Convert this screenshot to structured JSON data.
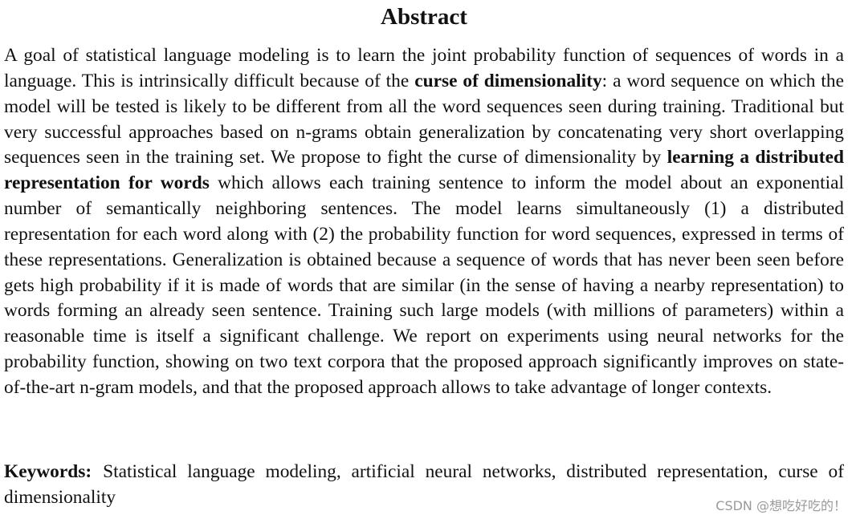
{
  "title": "Abstract",
  "abstract": {
    "segments": [
      {
        "text": " A goal of statistical language modeling is to learn the joint probability function of sequences of words in a language. This is intrinsically difficult because of the ",
        "bold": false
      },
      {
        "text": "curse of dimensionality",
        "bold": true
      },
      {
        "text": ": a word sequence on which the model will be tested is likely to be different from all the word sequences seen during training. Traditional but very successful approaches based on n-grams obtain generalization by concatenating very short overlapping sequences seen in the training set. We propose to fight the curse of dimensionality by ",
        "bold": false
      },
      {
        "text": "learning a distributed representation for words",
        "bold": true
      },
      {
        "text": " which allows each training sentence to inform the model about an exponential number of semantically neighboring sentences.  The model learns simultaneously (1) a distributed representation for each word along with (2) the probability function for word sequences, expressed in terms of these representations. Generalization is obtained because a sequence of words that has never been seen before gets high probability if it is made of words that are similar (in the sense of having a nearby representation) to words forming an already seen sentence. Training such large models (with millions of parameters) within a reasonable time is itself a significant challenge.  We report on experiments using neural networks for the probability function, showing on two text corpora that the proposed approach significantly improves on state-of-the-art n-gram models, and that the proposed approach allows to take advantage of longer contexts.",
        "bold": false
      }
    ]
  },
  "keywords": {
    "label": "Keywords:",
    "text": "Statistical language modeling, artificial neural networks, distributed representation, curse of dimensionality"
  },
  "watermark": "CSDN @想吃好吃的！"
}
